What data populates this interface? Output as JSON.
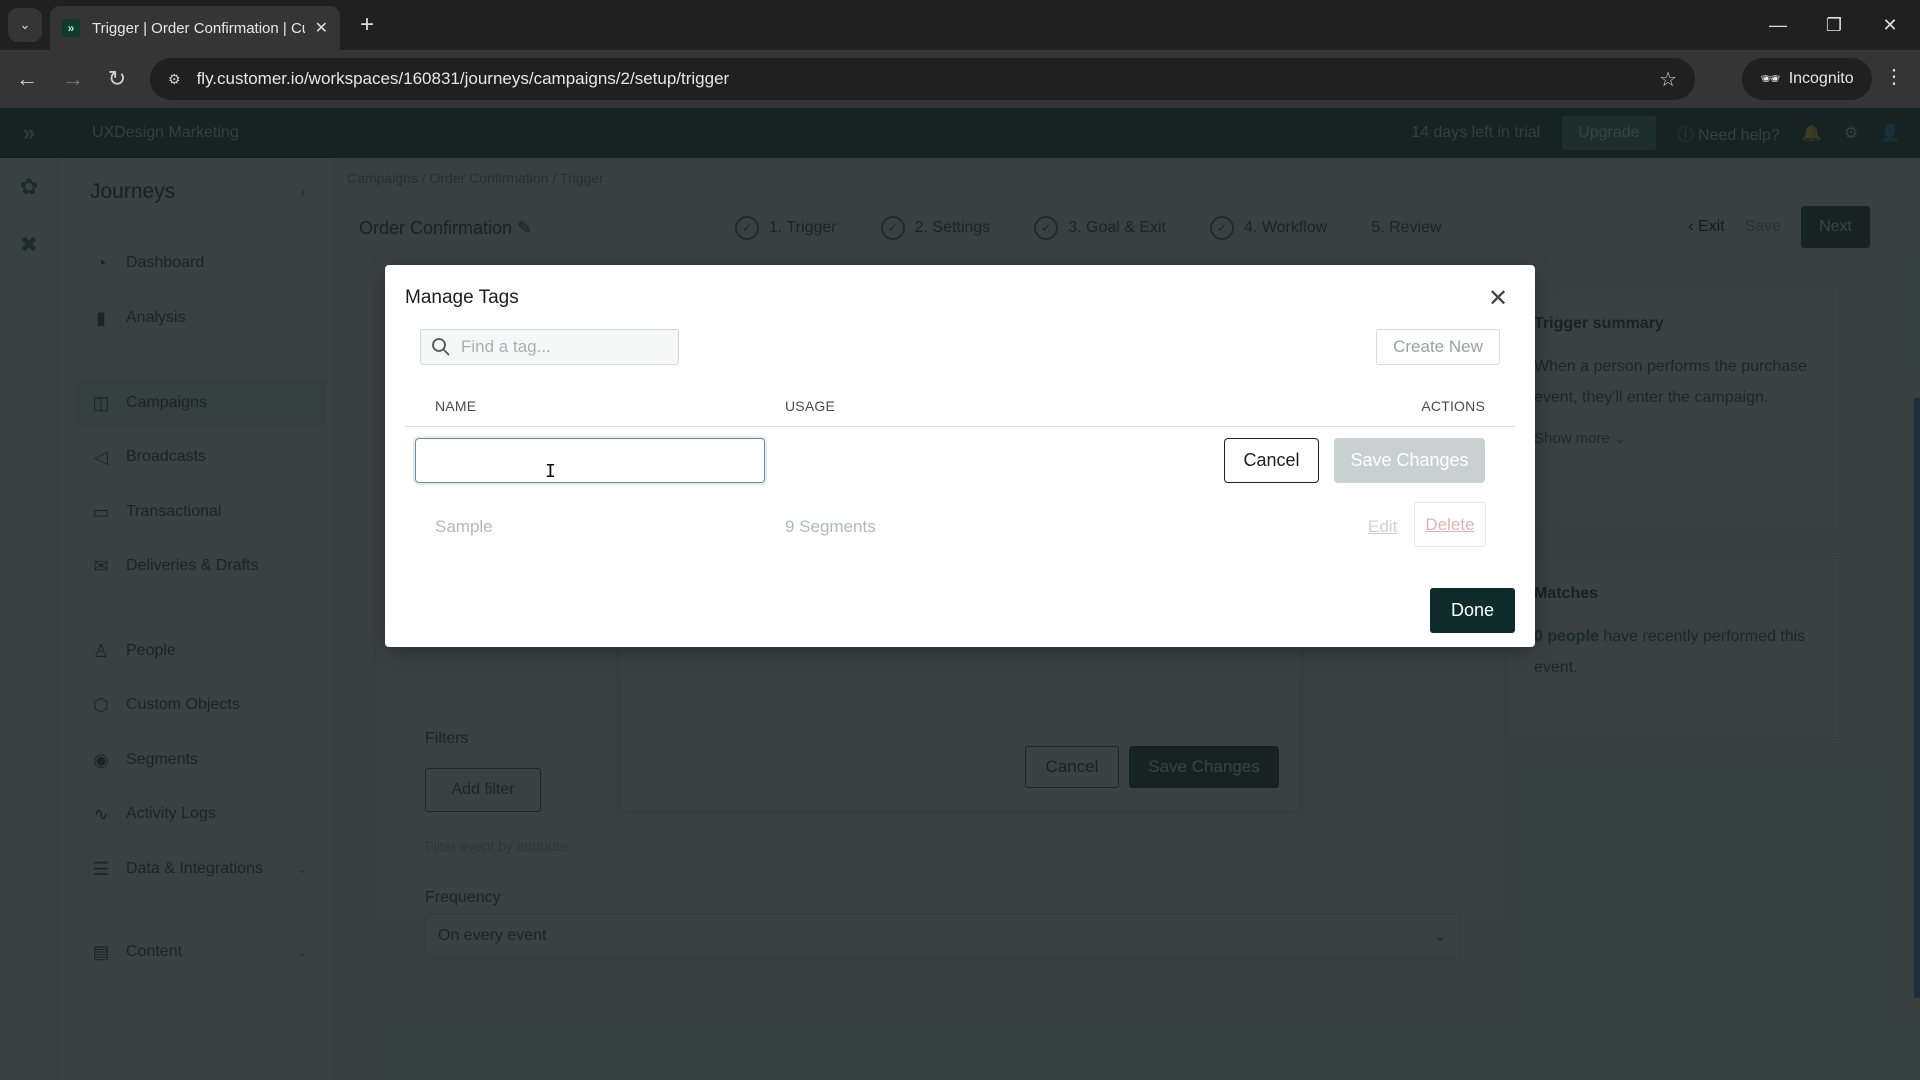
{
  "browser": {
    "tab_title": "Trigger | Order Confirmation | Customer.io",
    "url": "fly.customer.io/workspaces/160831/journeys/campaigns/2/setup/trigger",
    "incognito_label": "Incognito"
  },
  "app": {
    "workspace_name": "UXDesign Marketing",
    "trial_text": "14 days left in trial",
    "upgrade_label": "Upgrade",
    "help_label": "Need help?"
  },
  "sidebar": {
    "title": "Journeys",
    "items": [
      {
        "label": "Dashboard",
        "icon": "gauge-icon"
      },
      {
        "label": "Analysis",
        "icon": "bar-chart-icon"
      },
      {
        "label": "Campaigns",
        "icon": "campaign-icon",
        "active": true
      },
      {
        "label": "Broadcasts",
        "icon": "megaphone-icon"
      },
      {
        "label": "Transactional",
        "icon": "transactional-icon"
      },
      {
        "label": "Deliveries & Drafts",
        "icon": "envelope-icon"
      },
      {
        "label": "People",
        "icon": "person-icon"
      },
      {
        "label": "Custom Objects",
        "icon": "cube-icon"
      },
      {
        "label": "Segments",
        "icon": "segment-icon"
      },
      {
        "label": "Activity Logs",
        "icon": "pulse-icon"
      },
      {
        "label": "Data & Integrations",
        "icon": "database-icon"
      },
      {
        "label": "Content",
        "icon": "content-icon"
      }
    ]
  },
  "page": {
    "breadcrumb": [
      "Campaigns",
      "Order Confirmation",
      "Trigger"
    ],
    "campaign_title": "Order Confirmation",
    "steps": [
      "1. Trigger",
      "2. Settings",
      "3. Goal & Exit",
      "4. Workflow",
      "5. Review"
    ],
    "exit_label": "Exit",
    "save_label": "Save",
    "next_label": "Next",
    "filters_label": "Filters",
    "add_filter_label": "Add filter",
    "filter_hint": "Filter event by attribute",
    "frequency_label": "Frequency",
    "frequency_value": "On every event",
    "summary_title": "Trigger summary",
    "summary_text": "When a person performs the purchase event, they'll enter the campaign.",
    "show_more": "Show more",
    "matches_title": "Matches",
    "matches_count": "0 people",
    "matches_text": "have recently performed this event."
  },
  "inner_dialog": {
    "cancel_label": "Cancel",
    "save_label": "Save Changes"
  },
  "modal": {
    "title": "Manage Tags",
    "search_placeholder": "Find a tag...",
    "create_new_label": "Create New",
    "columns": {
      "name": "NAME",
      "usage": "USAGE",
      "actions": "ACTIONS"
    },
    "new_tag_value": "",
    "row_cancel_label": "Cancel",
    "row_save_label": "Save Changes",
    "tags": [
      {
        "name": "Sample",
        "usage": "9 Segments",
        "edit_label": "Edit",
        "delete_label": "Delete"
      }
    ],
    "done_label": "Done"
  }
}
